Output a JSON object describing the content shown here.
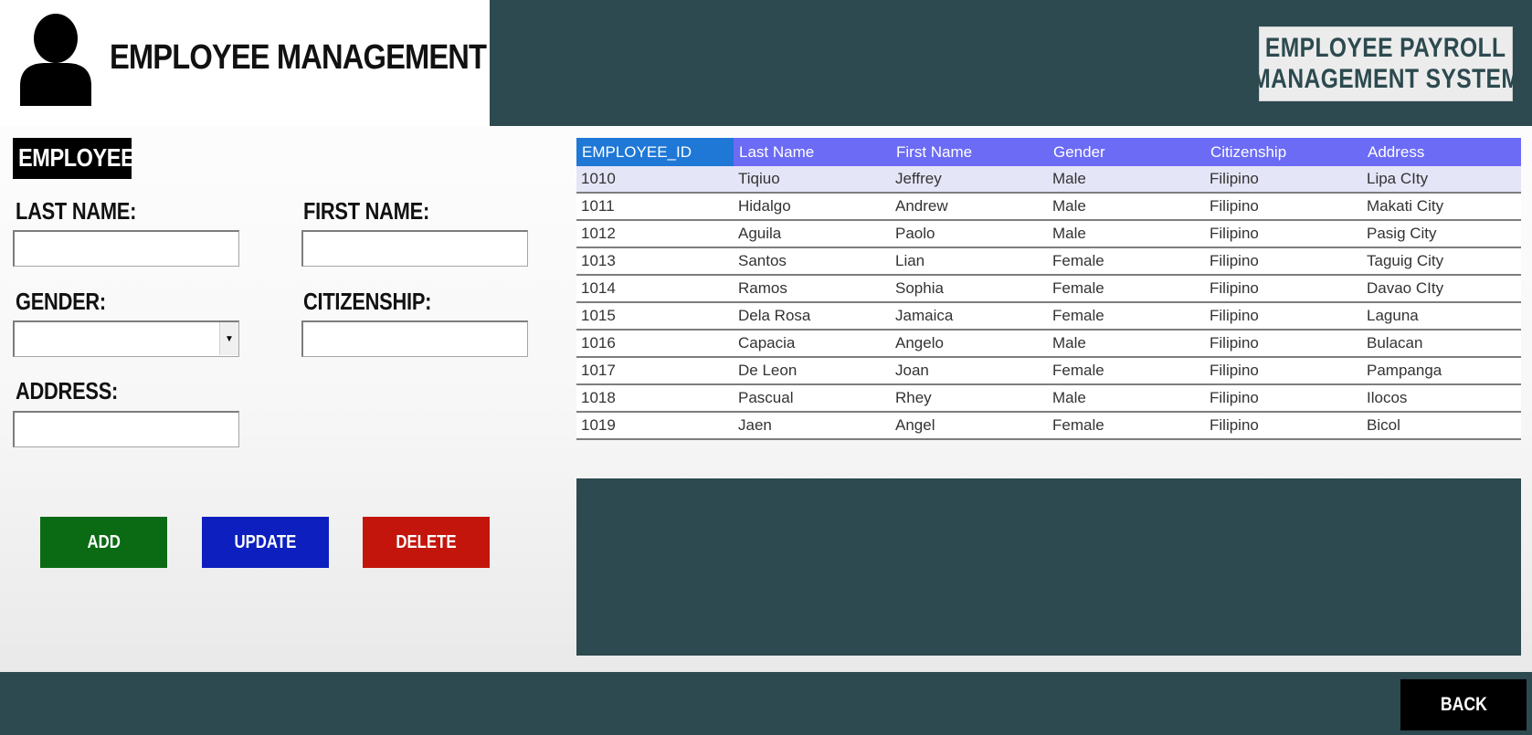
{
  "header": {
    "title": "EMPLOYEE MANAGEMENT",
    "system_title_line1": "EMPLOYEE  PAYROLL",
    "system_title_line2": "MANAGEMENT SYSTEM",
    "avatar_icon": "user-silhouette-icon"
  },
  "form": {
    "section_label": "EMPLOYEE",
    "last_name_label": "LAST NAME:",
    "first_name_label": "FIRST NAME:",
    "gender_label": "GENDER:",
    "citizenship_label": "CITIZENSHIP:",
    "address_label": "ADDRESS:",
    "last_name_value": "",
    "first_name_value": "",
    "gender_value": "",
    "citizenship_value": "",
    "address_value": ""
  },
  "buttons": {
    "add": "ADD",
    "update": "UPDATE",
    "delete": "DELETE",
    "back": "BACK"
  },
  "colors": {
    "panel": "#2c4a4f",
    "add": "#0b6b14",
    "update": "#0d1fbf",
    "delete": "#c4150c",
    "grid_header": "#6b6bf5",
    "grid_header_first": "#1f78d6"
  },
  "table": {
    "columns": [
      "EMPLOYEE_ID",
      "Last Name",
      "First Name",
      "Gender",
      "Citizenship",
      "Address"
    ],
    "rows": [
      [
        "1010",
        "Tiqiuo",
        "Jeffrey",
        "Male",
        "Filipino",
        "Lipa CIty"
      ],
      [
        "1011",
        "Hidalgo",
        "Andrew",
        "Male",
        "Filipino",
        "Makati City"
      ],
      [
        "1012",
        "Aguila",
        "Paolo",
        "Male",
        "Filipino",
        "Pasig City"
      ],
      [
        "1013",
        "Santos",
        "Lian",
        "Female",
        "Filipino",
        "Taguig City"
      ],
      [
        "1014",
        "Ramos",
        "Sophia",
        "Female",
        "Filipino",
        "Davao CIty"
      ],
      [
        "1015",
        "Dela Rosa",
        "Jamaica",
        "Female",
        "Filipino",
        "Laguna"
      ],
      [
        "1016",
        "Capacia",
        "Angelo",
        "Male",
        "Filipino",
        "Bulacan"
      ],
      [
        "1017",
        "De Leon",
        "Joan",
        "Female",
        "Filipino",
        "Pampanga"
      ],
      [
        "1018",
        "Pascual",
        "Rhey",
        "Male",
        "Filipino",
        "Ilocos"
      ],
      [
        "1019",
        "Jaen",
        "Angel",
        "Female",
        "Filipino",
        "Bicol"
      ]
    ]
  }
}
